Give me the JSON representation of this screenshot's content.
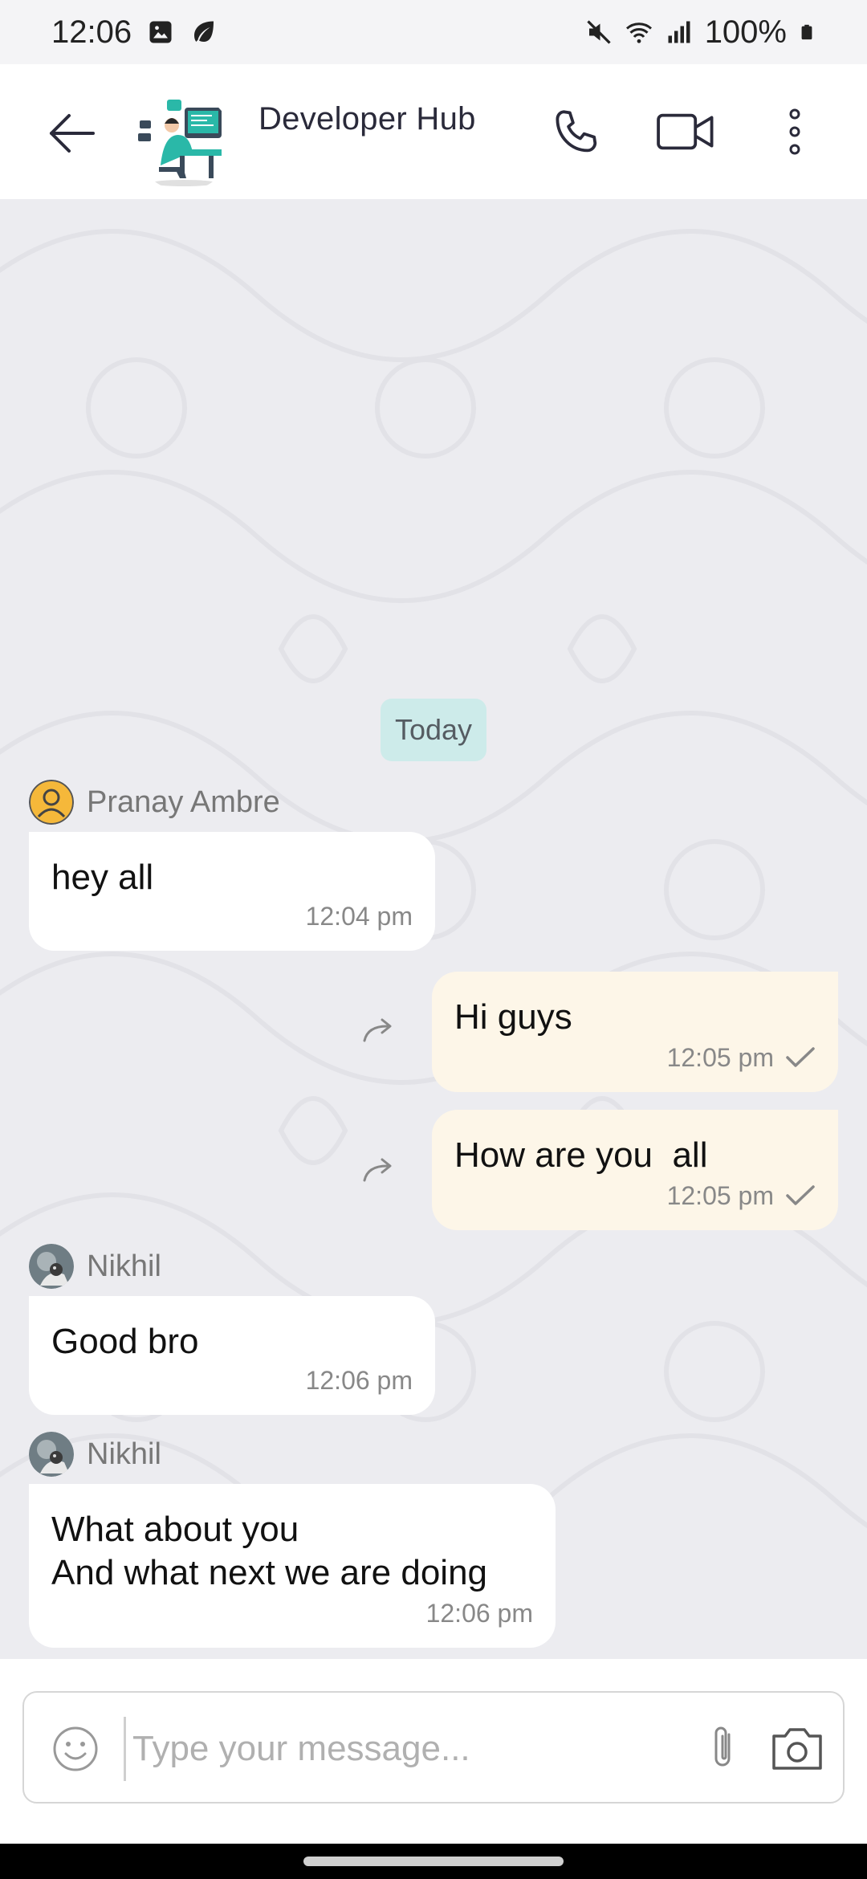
{
  "status_bar": {
    "time": "12:06",
    "battery": "100%",
    "icons": [
      "image-icon",
      "leaf-icon",
      "mute-icon",
      "wifi-icon",
      "signal-icon",
      "battery-icon"
    ]
  },
  "header": {
    "title": "Developer Hub",
    "icons": [
      "back-arrow-icon",
      "phone-icon",
      "video-camera-icon",
      "more-vert-icon"
    ]
  },
  "chat": {
    "date_chip": "Today",
    "messages": [
      {
        "direction": "in",
        "sender": "Pranay Ambre",
        "avatar": "default-user-icon",
        "text": "hey all",
        "time": "12:04 pm"
      },
      {
        "direction": "out",
        "text": "Hi guys",
        "time": "12:05 pm",
        "status": "sent"
      },
      {
        "direction": "out",
        "text": "How are you  all",
        "time": "12:05 pm",
        "status": "sent"
      },
      {
        "direction": "in",
        "sender": "Nikhil",
        "avatar": "photo-avatar",
        "text": "Good bro",
        "time": "12:06 pm"
      },
      {
        "direction": "in",
        "sender": "Nikhil",
        "avatar": "photo-avatar",
        "text": "What about you\nAnd what next we are doing",
        "time": "12:06 pm"
      }
    ]
  },
  "composer": {
    "placeholder": "Type your message...",
    "value": ""
  },
  "colors": {
    "chat_bg": "#ececf0",
    "incoming_bubble": "#ffffff",
    "outgoing_bubble": "#fdf6e8",
    "date_chip": "#cdebea"
  }
}
